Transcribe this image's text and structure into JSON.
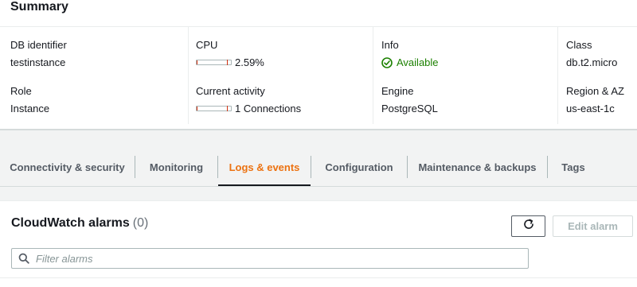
{
  "summary": {
    "title": "Summary",
    "db_identifier": {
      "label": "DB identifier",
      "value": "testinstance"
    },
    "role": {
      "label": "Role",
      "value": "Instance"
    },
    "cpu": {
      "label": "CPU",
      "value": "2.59%",
      "meter_percent": 2.59
    },
    "current_activity": {
      "label": "Current activity",
      "value": "1 Connections"
    },
    "info": {
      "label": "Info",
      "value": "Available",
      "status_color": "#1d8102"
    },
    "engine": {
      "label": "Engine",
      "value": "PostgreSQL"
    },
    "class": {
      "label": "Class",
      "value": "db.t2.micro"
    },
    "region_az": {
      "label": "Region & AZ",
      "value": "us-east-1c"
    }
  },
  "tabs": [
    {
      "label": "Connectivity & security"
    },
    {
      "label": "Monitoring"
    },
    {
      "label": "Logs & events",
      "active": true
    },
    {
      "label": "Configuration"
    },
    {
      "label": "Maintenance & backups"
    },
    {
      "label": "Tags"
    }
  ],
  "alarms": {
    "title": "CloudWatch alarms",
    "count": "(0)",
    "refresh_icon": "refresh-icon",
    "edit_label": "Edit alarm",
    "search_placeholder": "Filter alarms",
    "search_value": ""
  },
  "colors": {
    "accent": "#ec7211",
    "success": "#1d8102",
    "meter": "#d13212"
  }
}
